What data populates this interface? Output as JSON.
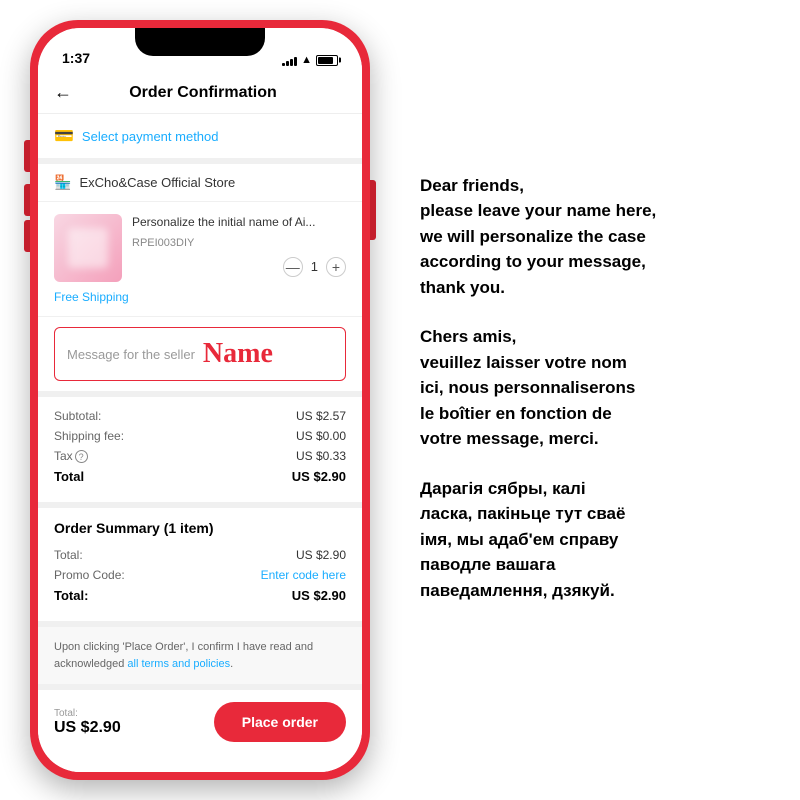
{
  "phone": {
    "status_bar": {
      "time": "1:37",
      "signal_bars": [
        3,
        5,
        7,
        9,
        11
      ],
      "wifi": "wifi",
      "battery_label": "battery"
    },
    "header": {
      "title": "Order Confirmation",
      "back_label": "←"
    },
    "payment": {
      "icon": "💳",
      "text": "Select payment method"
    },
    "store": {
      "icon": "🏪",
      "name": "ExCho&Case Official Store"
    },
    "product": {
      "name": "Personalize the initial name of Ai...",
      "sku": "RPEI003DIY",
      "qty": "1",
      "qty_minus": "—",
      "qty_plus": "+"
    },
    "free_shipping": "Free Shipping",
    "message": {
      "placeholder": "Message for the seller",
      "name_highlight": "Name"
    },
    "pricing": {
      "subtotal_label": "Subtotal:",
      "subtotal_value": "US $2.57",
      "shipping_label": "Shipping fee:",
      "shipping_value": "US $0.00",
      "tax_label": "Tax",
      "tax_value": "US $0.33",
      "total_label": "Total",
      "total_value": "US $2.90"
    },
    "order_summary": {
      "title": "Order Summary (1 item)",
      "total_label": "Total:",
      "total_value": "US $2.90",
      "promo_label": "Promo Code:",
      "promo_link": "Enter code here",
      "final_label": "Total:",
      "final_value": "US $2.90"
    },
    "terms": {
      "text": "Upon clicking 'Place Order', I confirm I have read and acknowledged ",
      "link_text": "all terms and policies",
      "period": "."
    },
    "place_order": {
      "total_label": "Total:",
      "total_value": "US $2.90",
      "button_label": "Place order"
    }
  },
  "text_panel": {
    "block1": {
      "line1": "Dear friends,",
      "line2": "please leave your name here,",
      "line3": "we will personalize the case",
      "line4": "according to your message,",
      "line5": "thank you."
    },
    "block2": {
      "line1": "Chers amis,",
      "line2": "veuillez laisser votre nom",
      "line3": "ici, nous personnaliserons",
      "line4": "le boîtier en fonction de",
      "line5": "votre message, merci."
    },
    "block3": {
      "line1": "Дарагія сябры, калі",
      "line2": "ласка, пакіньце тут сваё",
      "line3": "імя, мы адаб'ем справу",
      "line4": "паводле вашага",
      "line5": "паведамлення, дзякуй."
    }
  }
}
